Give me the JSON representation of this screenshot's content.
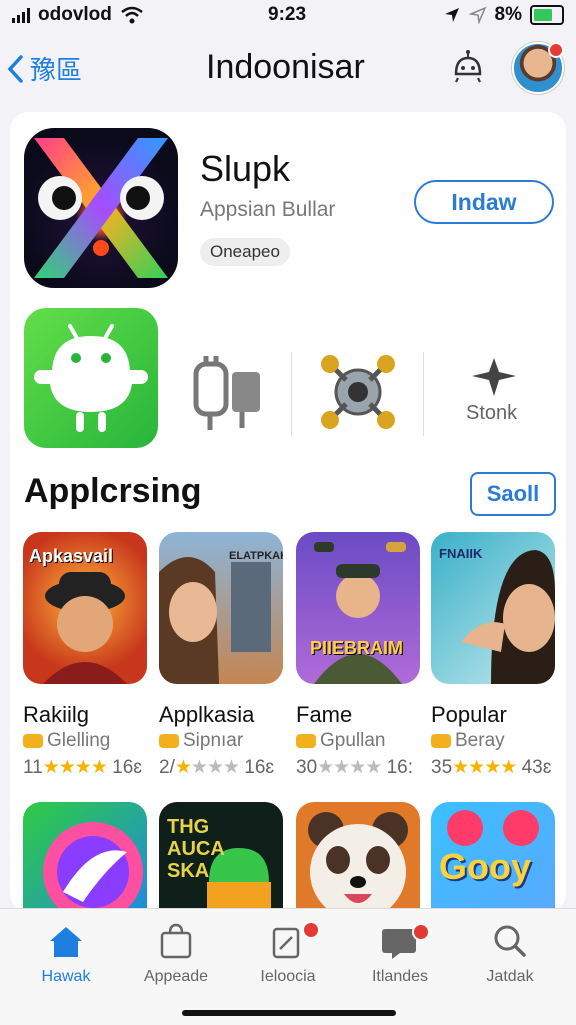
{
  "status": {
    "carrier": "odovlod",
    "time": "9:23",
    "battery": "8%"
  },
  "nav": {
    "back_label": "豫區",
    "title": "Indoonisar"
  },
  "hero": {
    "title": "Slupk",
    "subtitle": "Appsian Bullar",
    "badge": "Oneapeo",
    "install_label": "Indaw"
  },
  "tools": {
    "label": "Stonk"
  },
  "section": {
    "title": "Applcrsing",
    "see_all_label": "Saoll"
  },
  "apps": [
    {
      "name": "Rakiilg",
      "category": "Glelling",
      "rating_prefix": "11",
      "stars_on": "★★★★",
      "stars_off": "",
      "rating_count": "16ɛ",
      "tile_text": "Apkasvail"
    },
    {
      "name": "Applkasia",
      "category": "Sipnıar",
      "rating_prefix": "2/",
      "stars_on": "★",
      "stars_off": "★★★",
      "rating_count": "16ɛ",
      "tile_text": "ELATPKAK"
    },
    {
      "name": "Fame",
      "category": "Gpullan",
      "rating_prefix": "30",
      "stars_on": "",
      "stars_off": "★★★★",
      "rating_count": "16:",
      "tile_text": "PIIEBRAIM"
    },
    {
      "name": "Popular",
      "category": "Beray",
      "rating_prefix": "35",
      "stars_on": "★★★★",
      "stars_off": "",
      "rating_count": "43ɛ",
      "tile_text": "FNAIIK"
    }
  ],
  "row2": {
    "tile2_text": "THG AUCA SKA",
    "tile4_text": "Gooy"
  },
  "tabs": [
    {
      "label": "Hawak",
      "icon": "home-icon"
    },
    {
      "label": "Appeade",
      "icon": "bag-icon"
    },
    {
      "label": "Ieloocia",
      "icon": "tag-icon"
    },
    {
      "label": "Itlandes",
      "icon": "chat-icon"
    },
    {
      "label": "Jatdak",
      "icon": "search-icon"
    }
  ],
  "colors": {
    "accent": "#1f7fe0",
    "star": "#f5b400",
    "badge_red": "#e53935"
  }
}
